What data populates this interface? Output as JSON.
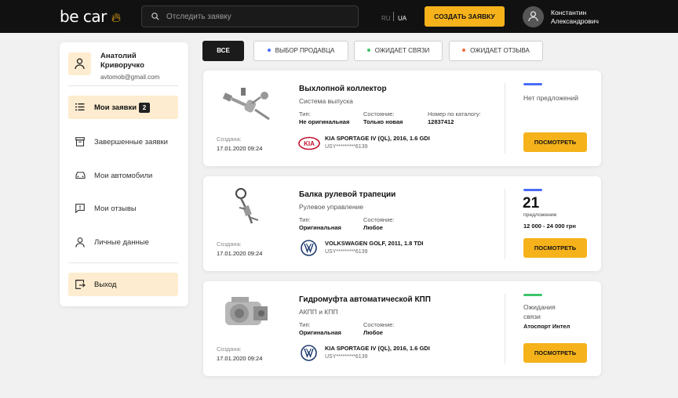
{
  "header": {
    "logo_text": "be car",
    "logo_icon": "flame-icon",
    "search_placeholder": "Отследить заявку",
    "lang_ru": "RU",
    "lang_ua": "UA",
    "create_button": "Создать заявку",
    "user_name_line1": "Константин",
    "user_name_line2": "Александрович"
  },
  "sidebar": {
    "profile_name_line1": "Анатолий",
    "profile_name_line2": "Криворучко",
    "profile_email": "avtomob@gmail.com",
    "items": [
      {
        "label": "Мои заявки",
        "badge": "2",
        "icon": "list-icon",
        "active": true
      },
      {
        "label": "Завершенные заявки",
        "icon": "archive-icon",
        "active": false
      },
      {
        "label": "Мои автомобили",
        "icon": "car-icon",
        "active": false
      },
      {
        "label": "Мои отзывы",
        "icon": "review-icon",
        "active": false
      },
      {
        "label": "Личные данные",
        "icon": "person-icon",
        "active": false
      }
    ],
    "logout_label": "Выход"
  },
  "filters": [
    {
      "label": "Все",
      "active": true
    },
    {
      "label": "Выбор продавца",
      "dot_color": "#4a6cf7"
    },
    {
      "label": "Ожидает связи",
      "dot_color": "#3cc46a"
    },
    {
      "label": "Ожидает отзыва",
      "dot_color": "#f06a3a"
    }
  ],
  "colors": {
    "accent": "#f5b21b",
    "header_bg": "#111111",
    "status_blue": "#4a6cf7",
    "status_green": "#3cc46a"
  },
  "cards": [
    {
      "title": "Выхлопной коллектор",
      "subtitle": "Система выпуска",
      "type_label": "Тип:",
      "type_value": "Не оригинальная",
      "state_label": "Состояние:",
      "state_value": "Только новая",
      "catalog_label": "Номер по каталогу:",
      "catalog_value": "12837412",
      "created_label": "Создана:",
      "created_value": "17.01.2020 09:24",
      "brand": "KIA",
      "car": "KIA SPORTAGE IV (QL), 2016, 1.6 GDI",
      "vin": "USY*********6139",
      "status_text": "Нет предложений",
      "button": "Посмотреть"
    },
    {
      "title": "Балка рулевой трапеции",
      "subtitle": "Рулевое управление",
      "type_label": "Тип:",
      "type_value": "Оригинальная",
      "state_label": "Состояние:",
      "state_value": "Любое",
      "created_label": "Создана:",
      "created_value": "17.01.2020 09:24",
      "brand": "VW",
      "car": "VOLKSWAGEN GOLF, 2011, 1.8 TDI",
      "vin": "USY*********6139",
      "offers_count": "21",
      "offers_label": "предложение",
      "price_range": "12 000 - 24 000 грн",
      "button": "Посмотреть"
    },
    {
      "title": "Гидромуфта автоматической КПП",
      "subtitle": "АКПП и КПП",
      "type_label": "Тип:",
      "type_value": "Оригинальная",
      "state_label": "Состояние:",
      "state_value": "Любое",
      "created_label": "Создана:",
      "created_value": "17.01.2020 09:24",
      "brand": "VW",
      "car": "KIA SPORTAGE IV (QL), 2016, 1.6 GDI",
      "vin": "USY*********6139",
      "status_text": "Ожидания связи",
      "seller": "Атоспорт Интел",
      "button": "Посмотреть"
    }
  ]
}
